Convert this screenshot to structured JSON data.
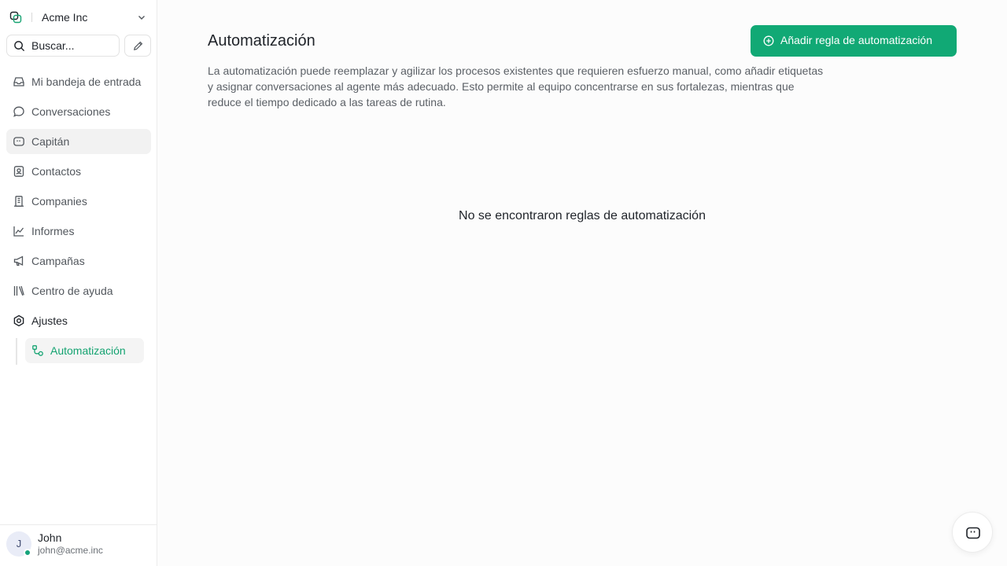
{
  "workspace": {
    "name": "Acme Inc"
  },
  "search": {
    "placeholder": "Buscar..."
  },
  "sidebar": {
    "items": [
      {
        "label": "Mi bandeja de entrada",
        "icon": "inbox-icon"
      },
      {
        "label": "Conversaciones",
        "icon": "chat-bubble-icon"
      },
      {
        "label": "Capitán",
        "icon": "captain-icon"
      },
      {
        "label": "Contactos",
        "icon": "contacts-icon"
      },
      {
        "label": "Companies",
        "icon": "building-icon"
      },
      {
        "label": "Informes",
        "icon": "chart-line-icon"
      },
      {
        "label": "Campañas",
        "icon": "megaphone-icon"
      },
      {
        "label": "Centro de ayuda",
        "icon": "library-icon"
      },
      {
        "label": "Ajustes",
        "icon": "gear-icon"
      }
    ],
    "sub_items": [
      {
        "label": "Automatización",
        "icon": "automation-icon"
      }
    ]
  },
  "user": {
    "initial": "J",
    "name": "John",
    "email": "john@acme.inc"
  },
  "main": {
    "title": "Automatización",
    "add_button_label": "Añadir regla de automatización",
    "description": "La automatización puede reemplazar y agilizar los procesos existentes que requieren esfuerzo manual, como añadir etiquetas y asignar conversaciones al agente más adecuado. Esto permite al equipo concentrarse en sus fortalezas, mientras que reduce el tiempo dedicado a las tareas de rutina.",
    "empty_state": "No se encontraron reglas de automatización"
  },
  "colors": {
    "accent": "#11a975",
    "active_text": "#14a371",
    "online": "#16a37b"
  }
}
